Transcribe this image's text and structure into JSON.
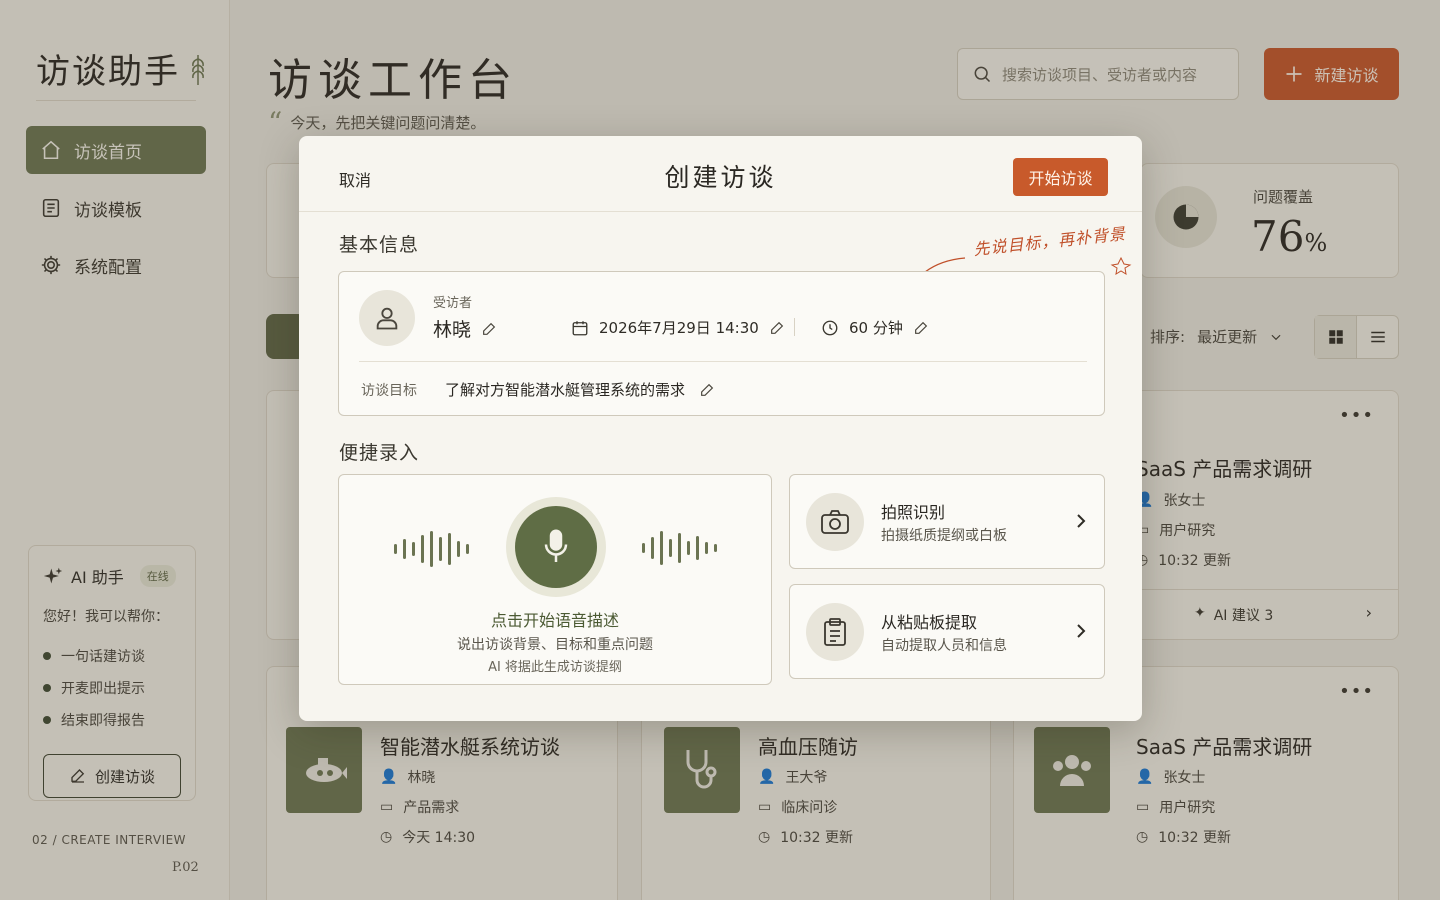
{
  "sidebar": {
    "logo": "访谈助手",
    "nav": [
      {
        "label": "访谈首页",
        "icon": "home-icon",
        "active": true
      },
      {
        "label": "访谈模板",
        "icon": "document-icon",
        "active": false
      },
      {
        "label": "系统配置",
        "icon": "gear-icon",
        "active": false
      }
    ],
    "ai": {
      "title": "AI 助手",
      "status": "在线",
      "greeting": "您好！我可以帮你：",
      "items": [
        "一句话建访谈",
        "开麦即出提示",
        "结束即得报告"
      ],
      "create_label": "创建访谈"
    },
    "page_code": "02 / CREATE INTERVIEW",
    "page_num": "P.02"
  },
  "header": {
    "title": "访谈工作台",
    "subtitle": "今天，先把关键问题问清楚。",
    "search_placeholder": "搜索访谈项目、受访者或内容",
    "new_button": "新建访谈"
  },
  "stats": {
    "label": "问题覆盖",
    "value": "76",
    "unit": "%"
  },
  "sort": {
    "label": "排序:",
    "value": "最近更新"
  },
  "cards": [
    {
      "title": "SaaS 产品需求调研",
      "person": "张女士",
      "category": "用户研究",
      "time": "10:32 更新",
      "ai_suggest": "AI 建议 3"
    },
    {
      "title": "智能潜水艇系统访谈",
      "person": "林晓",
      "category": "产品需求",
      "time": "今天 14:30"
    },
    {
      "title": "高血压随访",
      "person": "王大爷",
      "category": "临床问诊",
      "time": "10:32 更新"
    },
    {
      "title": "SaaS 产品需求调研",
      "person": "张女士",
      "category": "用户研究",
      "time": "10:32 更新"
    }
  ],
  "modal": {
    "cancel": "取消",
    "title": "创建访谈",
    "start": "开始访谈",
    "basic_title": "基本信息",
    "note": "先说目标，再补背景",
    "interviewee_label": "受访者",
    "interviewee_name": "林晓",
    "datetime": "2026年7月29日 14:30",
    "duration": "60 分钟",
    "goal_label": "访谈目标",
    "goal_value": "了解对方智能潜水艇管理系统的需求",
    "quick_title": "便捷录入",
    "voice": {
      "title": "点击开始语音描述",
      "subtitle": "说出访谈背景、目标和重点问题",
      "hint": "AI 将据此生成访谈提纲"
    },
    "photo": {
      "title": "拍照识别",
      "subtitle": "拍摄纸质提纲或白板"
    },
    "clipboard": {
      "title": "从粘贴板提取",
      "subtitle": "自动提取人员和信息"
    }
  },
  "colors": {
    "accent": "#c85a2b",
    "olive": "#5f6d45",
    "background": "#e9e6dd"
  }
}
